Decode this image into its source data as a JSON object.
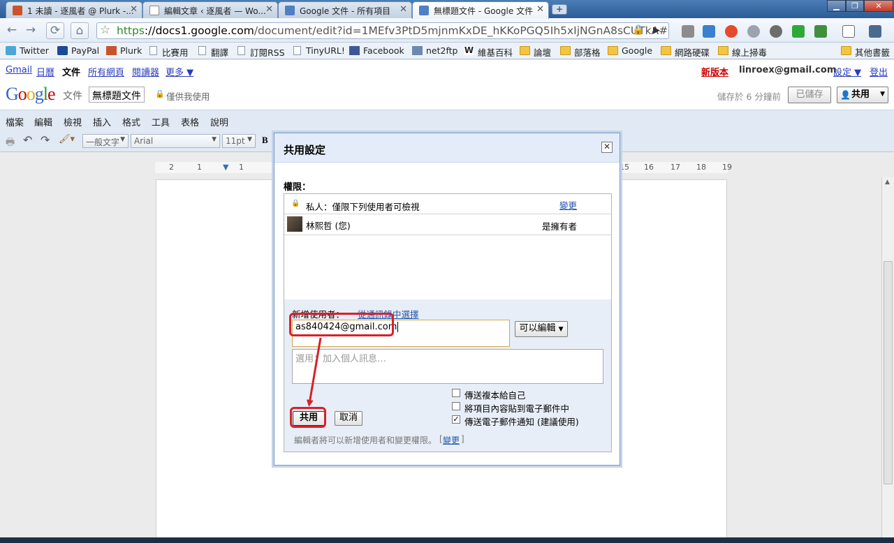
{
  "browser": {
    "tabs": [
      {
        "title": "1 未讀 - 逐風者 @ Plurk -...",
        "favicon": "plurk-icon"
      },
      {
        "title": "編輯文章 ‹ 逐風者 — Wo...",
        "favicon": "page-icon"
      },
      {
        "title": "Google 文件 - 所有項目",
        "favicon": "docs-icon"
      },
      {
        "title": "無標題文件 - Google 文件",
        "favicon": "docs-icon",
        "active": true
      }
    ],
    "url_scheme": "https",
    "url_host": "://docs1.google.com",
    "url_path": "/document/edit?id=1MEfv3PtD5mjnmKxDE_hKKoPGQ5Ih5xIjNGnA8sCUTkA#",
    "bookmarks": [
      "Twitter",
      "PayPal",
      "Plurk",
      "比賽用",
      "翻譯",
      "訂閱RSS",
      "TinyURL!",
      "Facebook",
      "net2ftp",
      "維基百科",
      "論壇",
      "部落格",
      "Google",
      "網路硬碟",
      "線上掃毒"
    ],
    "other_bookmarks": "其他書籤"
  },
  "gbar": {
    "left": [
      "Gmail",
      "日曆",
      "文件",
      "所有網頁",
      "閱讀器",
      "更多 ▼"
    ],
    "new_version": "新版本",
    "email": "linroex@gmail.com",
    "settings": "設定 ▼",
    "signout": "登出"
  },
  "doc": {
    "brand": "文件",
    "title": "無標題文件",
    "privacy": "僅供我使用",
    "saved_status": "儲存於 6 分鐘前",
    "saved_button": "已儲存",
    "share_button": "共用",
    "menu": [
      "檔案",
      "編輯",
      "檢視",
      "插入",
      "格式",
      "工具",
      "表格",
      "說明"
    ],
    "style_select": "一般文字",
    "font_select": "Arial",
    "size_select": "11pt",
    "bold": "B",
    "ruler_left": [
      "2",
      "1",
      "1"
    ],
    "ruler_right": [
      "15",
      "16",
      "17",
      "18",
      "19"
    ]
  },
  "dialog": {
    "title": "共用設定",
    "permissions_label": "權限：",
    "privacy_text": "私人：僅限下列使用者可檢視",
    "change_link": "變更",
    "owner_name": "林熙哲 (您)",
    "owner_role": "是擁有者",
    "add_user_label": "新增使用者：",
    "contacts_link": "從通訊錄中選擇",
    "email_value": "as840424@gmail.com",
    "permission_select": "可以編輯",
    "message_placeholder": "選用：加入個人訊息…",
    "options": [
      {
        "label": "傳送複本給自己",
        "checked": false
      },
      {
        "label": "將項目內容貼到電子郵件中",
        "checked": false
      },
      {
        "label": "傳送電子郵件通知 (建議使用)",
        "checked": true
      }
    ],
    "share_button": "共用",
    "cancel_button": "取消",
    "footer_note": "編輯者將可以新增使用者和變更權限。",
    "footer_link": "變更"
  }
}
